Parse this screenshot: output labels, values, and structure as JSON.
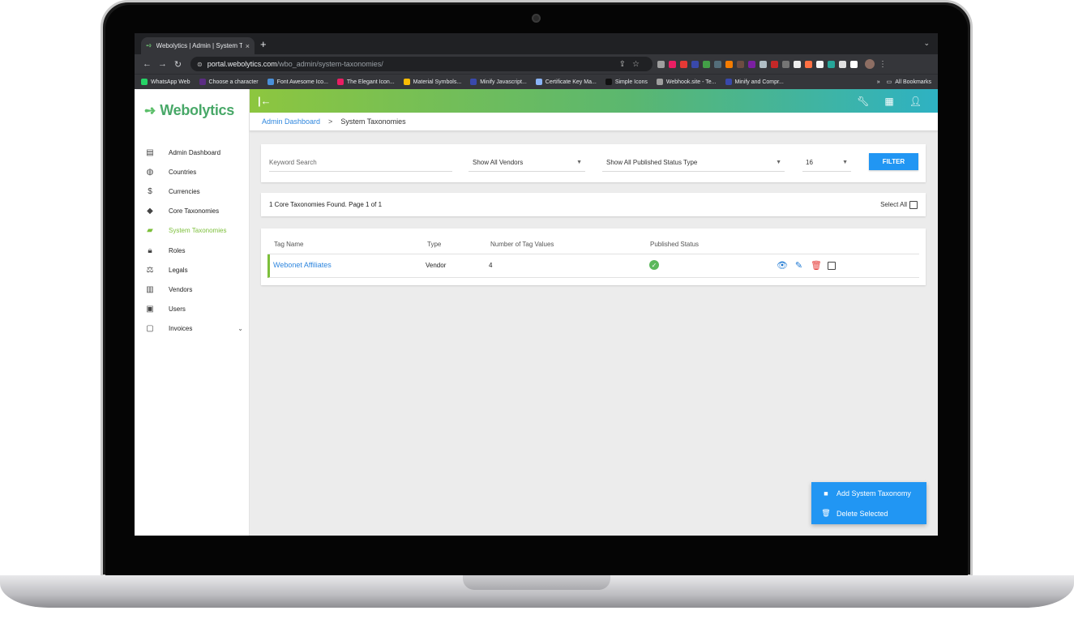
{
  "browser": {
    "tab_title": "Webolytics | Admin | System T",
    "tab_close": "×",
    "new_tab": "+",
    "url_host": "portal.webolytics.com",
    "url_path": "/wbo_admin/system-taxonomies/",
    "bookmarks": [
      {
        "label": "WhatsApp Web",
        "color": "#25d366"
      },
      {
        "label": "Choose a character",
        "color": "#5b2c83"
      },
      {
        "label": "Font Awesome Ico...",
        "color": "#4a90d9"
      },
      {
        "label": "The Elegant Icon...",
        "color": "#e91e63"
      },
      {
        "label": "Material Symbols...",
        "color": "#fbbc04"
      },
      {
        "label": "Minify Javascript...",
        "color": "#3949ab"
      },
      {
        "label": "Certificate Key Ma...",
        "color": "#8ab4f8"
      },
      {
        "label": "Simple Icons",
        "color": "#111111"
      },
      {
        "label": "Webhook.site - Te...",
        "color": "#9e9e9e"
      },
      {
        "label": "Minify and Compr...",
        "color": "#3949ab"
      }
    ],
    "bookmarks_more": "»",
    "all_bookmarks": "All Bookmarks"
  },
  "app": {
    "brand": "Webolytics",
    "sidebar": {
      "items": [
        {
          "label": "Admin Dashboard",
          "icon": "dashboard-icon"
        },
        {
          "label": "Countries",
          "icon": "globe-icon"
        },
        {
          "label": "Currencies",
          "icon": "dollar-icon"
        },
        {
          "label": "Core Taxonomies",
          "icon": "tags-icon"
        },
        {
          "label": "System Taxonomies",
          "icon": "label-icon",
          "active": true
        },
        {
          "label": "Roles",
          "icon": "lock-icon"
        },
        {
          "label": "Legals",
          "icon": "gavel-icon"
        },
        {
          "label": "Vendors",
          "icon": "building-icon"
        },
        {
          "label": "Users",
          "icon": "users-folder-icon"
        },
        {
          "label": "Invoices",
          "icon": "wallet-icon"
        }
      ]
    },
    "breadcrumb": {
      "parent": "Admin Dashboard",
      "current": "System Taxonomies"
    },
    "filters": {
      "keyword_placeholder": "Keyword Search",
      "vendor": "Show All Vendors",
      "status": "Show All Published Status Type",
      "per_page": "16",
      "button": "FILTER"
    },
    "results": {
      "summary": "1 Core Taxonomies Found. Page 1 of 1",
      "select_all": "Select All"
    },
    "table": {
      "headers": [
        "Tag Name",
        "Type",
        "Number of Tag Values",
        "Published Status"
      ],
      "rows": [
        {
          "name": "Webonet Affiliates",
          "type": "Vendor",
          "count": "4",
          "published": true
        }
      ]
    },
    "fab": {
      "add": "Add System Taxonomy",
      "delete": "Delete Selected"
    },
    "colors": {
      "accent": "#2196f3",
      "active_green": "#7cbf3a",
      "gradient_start": "#8dc63f",
      "gradient_end": "#2eb2c3"
    }
  }
}
